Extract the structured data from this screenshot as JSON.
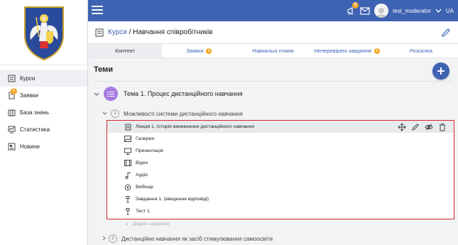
{
  "topbar": {
    "username": "test_moderator",
    "language": "UA",
    "notification_count": "5"
  },
  "header": {
    "breadcrumb_link": "Курси",
    "breadcrumb_sep": " / ",
    "breadcrumb_current": "Навчання співробітників"
  },
  "sidebar": {
    "items": [
      {
        "label": "Курси",
        "icon": "courses-icon",
        "active": true
      },
      {
        "label": "Заявки",
        "icon": "requests-icon",
        "badge": "1"
      },
      {
        "label": "База знань",
        "icon": "knowledge-base-icon"
      },
      {
        "label": "Статистика",
        "icon": "statistics-icon"
      },
      {
        "label": "Новини",
        "icon": "news-icon"
      }
    ]
  },
  "tabs": [
    {
      "label": "Контент",
      "active": true
    },
    {
      "label": "Заявки",
      "badge": "1"
    },
    {
      "label": "Навчальні плани"
    },
    {
      "label": "Неперевірені завдання",
      "badge": "1"
    },
    {
      "label": "Розсилка"
    }
  ],
  "main": {
    "section_title": "Теми",
    "topic_title": "Тема 1. Процес дистанційного навчання",
    "module1": {
      "number": "1",
      "title": "Можливості системи дистанційного навчання"
    },
    "lessons": [
      {
        "label": "Лекція 1. Історія виникнення дистанційного навчання",
        "icon": "lecture-icon"
      },
      {
        "label": "Галерея",
        "icon": "gallery-icon"
      },
      {
        "label": "Презентація",
        "icon": "presentation-icon"
      },
      {
        "label": "Відео",
        "icon": "video-icon"
      },
      {
        "label": "Аудіо",
        "icon": "audio-icon"
      },
      {
        "label": "Вебінар",
        "icon": "webinar-icon"
      },
      {
        "label": "Завдання 1. (введення відповіді)",
        "icon": "task-icon"
      },
      {
        "label": "Тест 1.",
        "icon": "test-icon"
      }
    ],
    "add_task_label": "Додати завдання",
    "module2": {
      "number": "2",
      "title": "Дистанційне навчання як засіб стимулювання самоосвіти"
    }
  },
  "colors": {
    "primary": "#3f63b3",
    "badge": "#f5a623",
    "topic": "#a77be0",
    "highlight_border": "#d9262a"
  }
}
